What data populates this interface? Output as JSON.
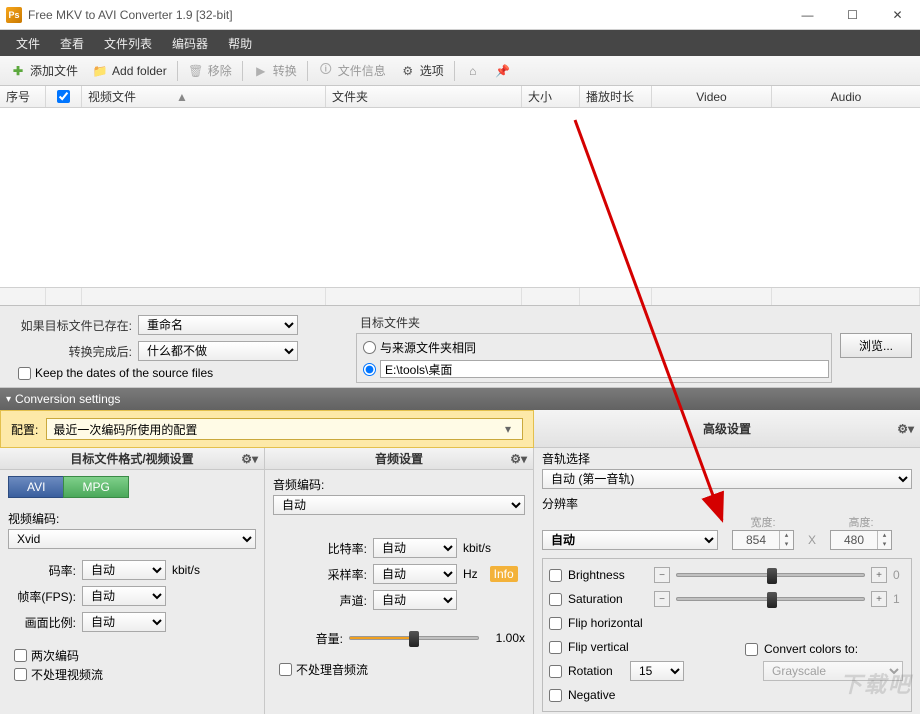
{
  "window": {
    "title": "Free MKV to AVI Converter 1.9  [32-bit]",
    "icon_text": "Ps"
  },
  "menu": {
    "file": "文件",
    "view": "查看",
    "filelist": "文件列表",
    "encoder": "编码器",
    "help": "帮助"
  },
  "toolbar": {
    "add_file": "添加文件",
    "add_folder": "Add folder",
    "remove": "移除",
    "convert": "转换",
    "file_info": "文件信息",
    "options": "选项"
  },
  "columns": {
    "seq": "序号",
    "video_file": "视频文件",
    "folder": "文件夹",
    "size": "大小",
    "duration": "播放时长",
    "video": "Video",
    "audio": "Audio"
  },
  "mid": {
    "if_exists_label": "如果目标文件已存在:",
    "if_exists_value": "重命名",
    "after_convert_label": "转换完成后:",
    "after_convert_value": "什么都不做",
    "keep_dates": "Keep the dates of the source files",
    "dest_folder_label": "目标文件夹",
    "same_as_source": "与来源文件夹相同",
    "custom_path": "E:\\tools\\桌面",
    "browse": "浏览..."
  },
  "conv": {
    "header": "Conversion settings",
    "config_label": "配置:",
    "config_value": "最近一次编码所使用的配置"
  },
  "video_pane": {
    "header": "目标文件格式/视频设置",
    "tab_avi": "AVI",
    "tab_mpg": "MPG",
    "encode_label": "视频编码:",
    "encode_value": "Xvid",
    "bitrate_label": "码率:",
    "bitrate_value": "自动",
    "bitrate_unit": "kbit/s",
    "fps_label": "帧率(FPS):",
    "fps_value": "自动",
    "aspect_label": "画面比例:",
    "aspect_value": "自动",
    "twopass": "两次编码",
    "skip_video": "不处理视频流"
  },
  "audio_pane": {
    "header": "音频设置",
    "encode_label": "音频编码:",
    "encode_value": "自动",
    "bitrate_label": "比特率:",
    "bitrate_value": "自动",
    "bitrate_unit": "kbit/s",
    "sample_label": "采样率:",
    "sample_value": "自动",
    "sample_unit": "Hz",
    "channel_label": "声道:",
    "channel_value": "自动",
    "volume_label": "音量:",
    "volume_value": "1.00x",
    "info": "Info",
    "skip_audio": "不处理音频流"
  },
  "adv_pane": {
    "header": "高级设置",
    "track_label": "音轨选择",
    "track_value": "自动 (第一音轨)",
    "res_label": "分辨率",
    "res_value": "自动",
    "width_label": "宽度:",
    "width_value": "854",
    "height_label": "高度:",
    "height_value": "480",
    "x": "X",
    "brightness": "Brightness",
    "brightness_val": "0",
    "saturation": "Saturation",
    "saturation_val": "1",
    "flip_h": "Flip horizontal",
    "flip_v": "Flip vertical",
    "rotation": "Rotation",
    "rotation_value": "15",
    "negative": "Negative",
    "convert_colors": "Convert colors to:",
    "grayscale": "Grayscale"
  },
  "watermark": "下载吧"
}
